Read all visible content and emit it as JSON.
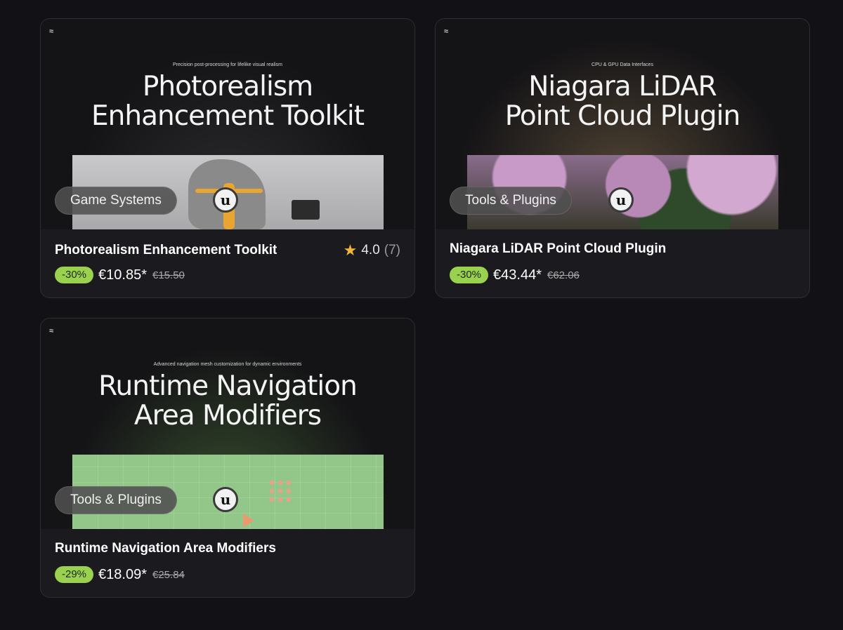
{
  "colors": {
    "background": "#121116",
    "card": "#1b1a1f",
    "discount_badge": "#9ad24f",
    "star": "#f2b632"
  },
  "products": [
    {
      "thumbnail": {
        "brand_mark": "≈",
        "subtitle": "Precision post-processing for lifelike visual realism",
        "title_line1": "Photorealism",
        "title_line2": "Enhancement Toolkit"
      },
      "category": "Game Systems",
      "engine_badge": "u",
      "title": "Photorealism Enhancement Toolkit",
      "rating": {
        "icon": "star-icon",
        "value": "4.0",
        "count": "(7)"
      },
      "discount": "-30%",
      "price": "€10.85*",
      "original_price": "€15.50"
    },
    {
      "thumbnail": {
        "brand_mark": "≈",
        "subtitle": "CPU & GPU Data Interfaces",
        "title_line1": "Niagara LiDAR",
        "title_line2": "Point Cloud Plugin"
      },
      "category": "Tools & Plugins",
      "engine_badge": "u",
      "title": "Niagara LiDAR Point Cloud Plugin",
      "discount": "-30%",
      "price": "€43.44*",
      "original_price": "€62.06"
    },
    {
      "thumbnail": {
        "brand_mark": "≈",
        "subtitle": "Advanced navigation mesh customization for dynamic environments",
        "title_line1": "Runtime Navigation",
        "title_line2": "Area Modifiers"
      },
      "category": "Tools & Plugins",
      "engine_badge": "u",
      "title": "Runtime Navigation Area Modifiers",
      "discount": "-29%",
      "price": "€18.09*",
      "original_price": "€25.84"
    }
  ]
}
